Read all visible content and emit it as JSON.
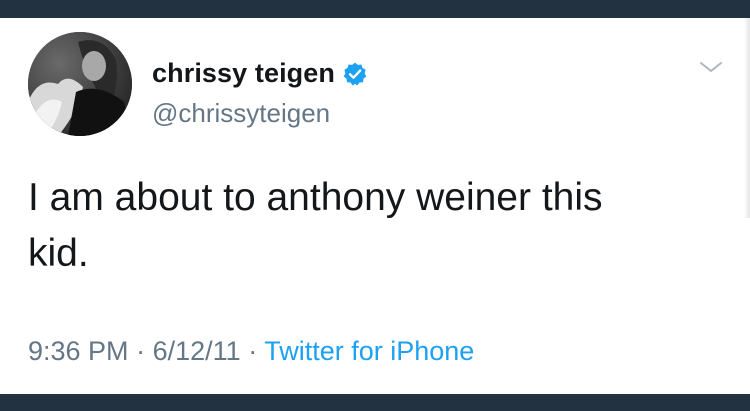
{
  "tweet": {
    "author": {
      "display_name": "chrissy teigen",
      "handle": "@chrissyteigen",
      "verified": true,
      "verified_icon": "verified-badge-icon"
    },
    "menu_icon": "chevron-down-icon",
    "text": "I am about to anthony weiner this kid.",
    "time": "9:36 PM",
    "separator": "·",
    "date": "6/12/11",
    "source": "Twitter for iPhone"
  },
  "colors": {
    "background": "#233240",
    "card": "#ffffff",
    "text": "#14171a",
    "muted": "#657786",
    "accent": "#1da1f2"
  }
}
